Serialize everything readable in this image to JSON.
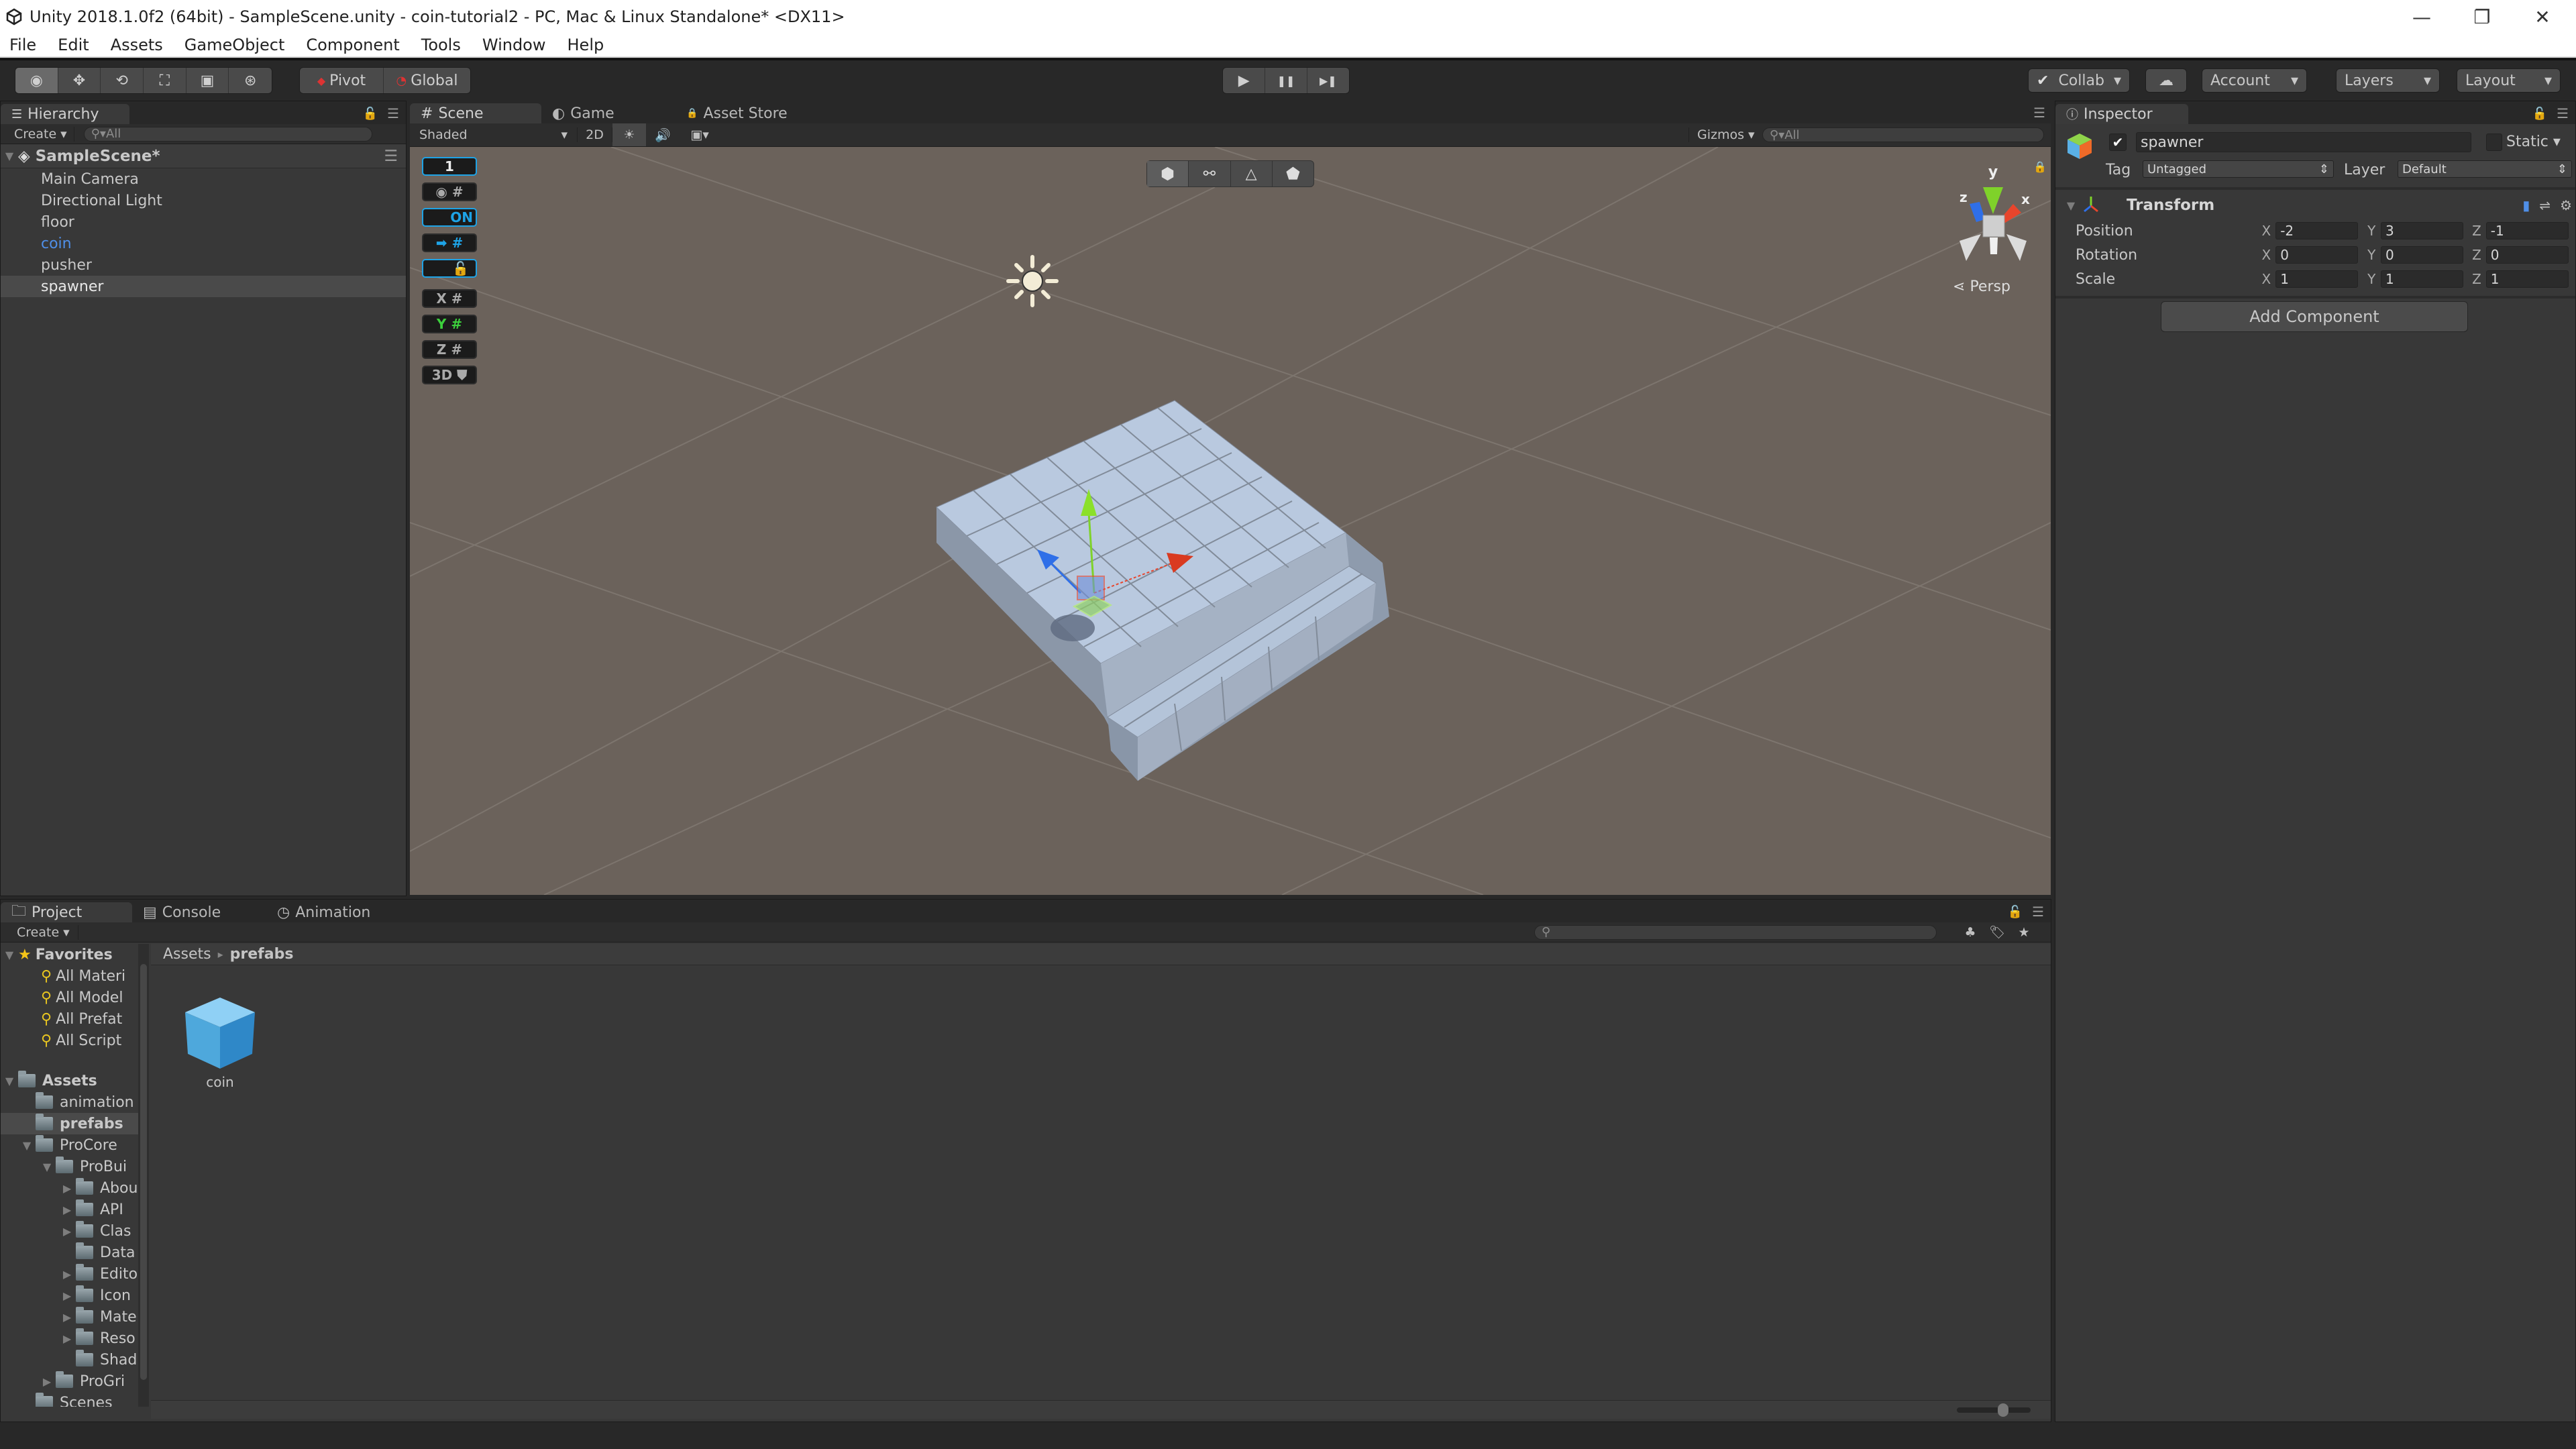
{
  "window": {
    "title": "Unity 2018.1.0f2 (64bit) - SampleScene.unity - coin-tutorial2 - PC, Mac & Linux Standalone* <DX11>",
    "controls": {
      "minimize": "—",
      "restore": "❐",
      "close": "✕"
    }
  },
  "menu": [
    "File",
    "Edit",
    "Assets",
    "GameObject",
    "Component",
    "Tools",
    "Window",
    "Help"
  ],
  "toolbar": {
    "tools": [
      {
        "name": "hand-tool",
        "glyph": "◉",
        "active": true
      },
      {
        "name": "move-tool",
        "glyph": "✥",
        "active": false
      },
      {
        "name": "rotate-tool",
        "glyph": "⟲",
        "active": false
      },
      {
        "name": "scale-tool",
        "glyph": "⛶",
        "active": false
      },
      {
        "name": "rect-tool",
        "glyph": "▣",
        "active": false
      },
      {
        "name": "transform-tool",
        "glyph": "⊛",
        "active": false
      }
    ],
    "pivot_label": "Pivot",
    "global_label": "Global",
    "play": "▶",
    "pause": "❚❚",
    "step": "▶❚",
    "collab_label": "Collab",
    "cloud": "☁",
    "account_label": "Account",
    "layers_label": "Layers",
    "layout_label": "Layout",
    "dropdown_arrow": "▾"
  },
  "hierarchy": {
    "tab_label": "Hierarchy",
    "create_label": "Create",
    "search_placeholder": "All",
    "scene_name": "SampleScene*",
    "items": [
      {
        "label": "Main Camera",
        "selected": false,
        "prefab": false
      },
      {
        "label": "Directional Light",
        "selected": false,
        "prefab": false
      },
      {
        "label": "floor",
        "selected": false,
        "prefab": false
      },
      {
        "label": "coin",
        "selected": false,
        "prefab": true
      },
      {
        "label": "pusher",
        "selected": false,
        "prefab": false
      },
      {
        "label": "spawner",
        "selected": true,
        "prefab": false
      }
    ]
  },
  "scene_tabs": [
    {
      "label": "Scene",
      "icon": "#",
      "active": true
    },
    {
      "label": "Game",
      "icon": "◐",
      "active": false
    },
    {
      "label": "Asset Store",
      "icon": "🔒",
      "active": false
    }
  ],
  "scene_toolbar": {
    "shading_mode": "Shaded",
    "mode_2d": "2D",
    "gizmos_label": "Gizmos",
    "search_placeholder": "All"
  },
  "progrids": {
    "snap_value": "1",
    "on_label": "ON",
    "axes": [
      "X",
      "Y",
      "Z"
    ],
    "mode_3d": "3D"
  },
  "gizmo": {
    "axis_labels": {
      "x": "x",
      "y": "y",
      "z": "z"
    },
    "projection": "Persp"
  },
  "inspector": {
    "tab_label": "Inspector",
    "object_name": "spawner",
    "active": true,
    "static_label": "Static",
    "static_checked": false,
    "tag_label": "Tag",
    "tag_value": "Untagged",
    "layer_label": "Layer",
    "layer_value": "Default",
    "transform": {
      "title": "Transform",
      "rows": [
        {
          "label": "Position",
          "x": "-2",
          "y": "3",
          "z": "-1"
        },
        {
          "label": "Rotation",
          "x": "0",
          "y": "0",
          "z": "0"
        },
        {
          "label": "Scale",
          "x": "1",
          "y": "1",
          "z": "1"
        }
      ],
      "axis_x": "X",
      "axis_y": "Y",
      "axis_z": "Z"
    },
    "add_component_label": "Add Component"
  },
  "bottom_tabs": [
    {
      "label": "Project",
      "active": true
    },
    {
      "label": "Console",
      "active": false
    },
    {
      "label": "Animation",
      "active": false
    }
  ],
  "project": {
    "create_label": "Create",
    "favorites_label": "Favorites",
    "favorites": [
      "All Materi",
      "All Model",
      "All Prefat",
      "All Script"
    ],
    "assets_label": "Assets",
    "tree": [
      {
        "label": "animation",
        "depth": 1,
        "arrow": "",
        "selected": false
      },
      {
        "label": "prefabs",
        "depth": 1,
        "arrow": "",
        "selected": true
      },
      {
        "label": "ProCore",
        "depth": 1,
        "arrow": "▼",
        "selected": false
      },
      {
        "label": "ProBui",
        "depth": 2,
        "arrow": "▼",
        "selected": false
      },
      {
        "label": "Abou",
        "depth": 3,
        "arrow": "▶",
        "selected": false
      },
      {
        "label": "API",
        "depth": 3,
        "arrow": "▶",
        "selected": false
      },
      {
        "label": "Clas",
        "depth": 3,
        "arrow": "▶",
        "selected": false
      },
      {
        "label": "Data",
        "depth": 3,
        "arrow": "",
        "selected": false
      },
      {
        "label": "Edito",
        "depth": 3,
        "arrow": "▶",
        "selected": false
      },
      {
        "label": "Icon",
        "depth": 3,
        "arrow": "▶",
        "selected": false
      },
      {
        "label": "Mate",
        "depth": 3,
        "arrow": "▶",
        "selected": false
      },
      {
        "label": "Reso",
        "depth": 3,
        "arrow": "▶",
        "selected": false
      },
      {
        "label": "Shad",
        "depth": 3,
        "arrow": "",
        "selected": false
      },
      {
        "label": "ProGri",
        "depth": 2,
        "arrow": "▶",
        "selected": false
      },
      {
        "label": "Scenes",
        "depth": 1,
        "arrow": "",
        "selected": false
      }
    ],
    "breadcrumb": [
      "Assets",
      "prefabs"
    ],
    "breadcrumb_sep": "▸",
    "items": [
      {
        "label": "coin",
        "type": "prefab"
      }
    ],
    "thumbnail_zoom": 0.55
  },
  "colors": {
    "accent_blue": "#1ea3e6",
    "prefab_blue": "#4f8fe8",
    "x_axis": "#e8452c",
    "y_axis": "#7fd22a",
    "z_axis": "#2f6fe8",
    "scene_bg": "#6b625b",
    "floor": "#b8c8de"
  }
}
